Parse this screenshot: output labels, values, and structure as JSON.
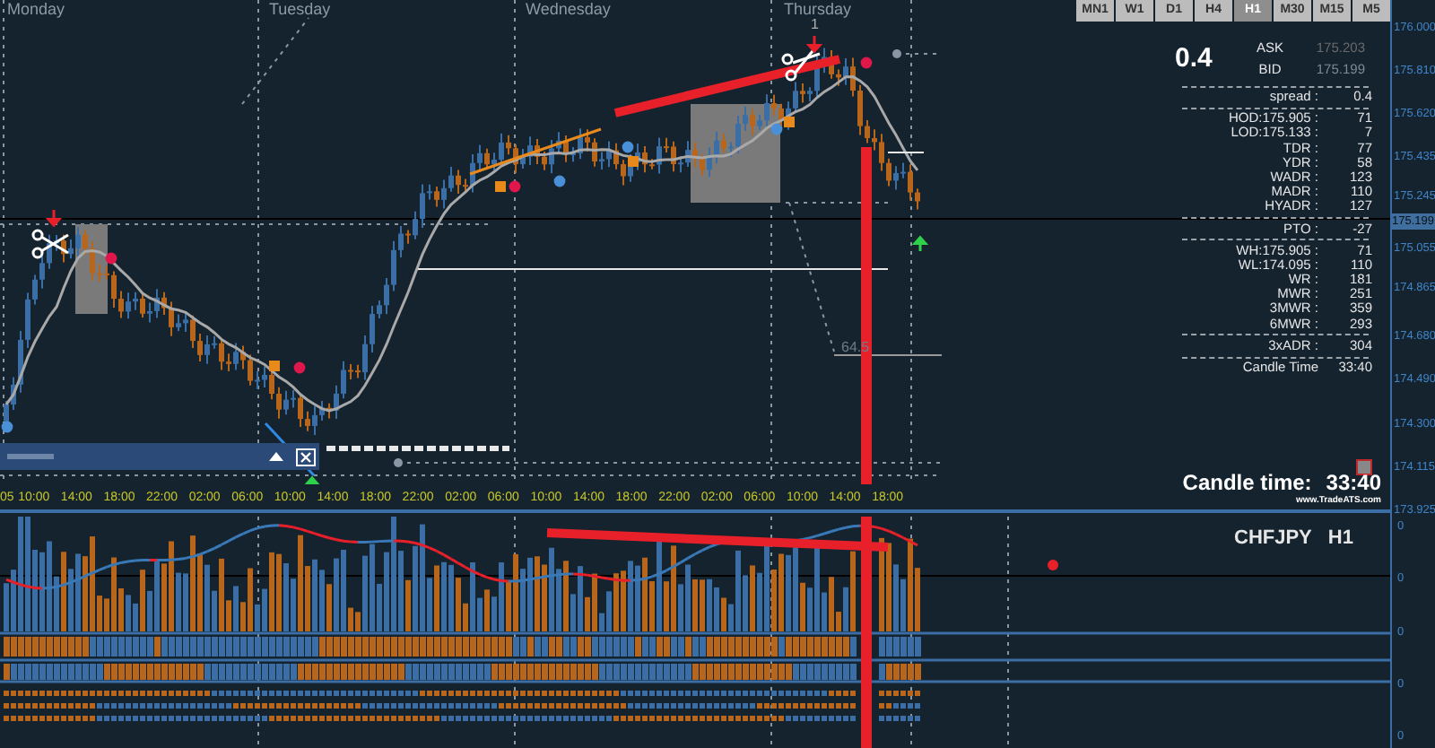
{
  "timeframes": [
    {
      "label": "MN1",
      "selected": false
    },
    {
      "label": "W1",
      "selected": false
    },
    {
      "label": "D1",
      "selected": false
    },
    {
      "label": "H4",
      "selected": false
    },
    {
      "label": "H1",
      "selected": true
    },
    {
      "label": "M30",
      "selected": false
    },
    {
      "label": "M15",
      "selected": false
    },
    {
      "label": "M5",
      "selected": false
    }
  ],
  "day_labels": [
    "Monday",
    "Tuesday",
    "Wednesday",
    "Thursday"
  ],
  "chart_labels": {
    "signal_count": "1",
    "level": "64.5"
  },
  "time_labels": [
    "05",
    "10:00",
    "14:00",
    "18:00",
    "22:00",
    "02:00",
    "06:00",
    "10:00",
    "14:00",
    "18:00",
    "22:00",
    "02:00",
    "06:00",
    "10:00",
    "14:00",
    "18:00",
    "22:00",
    "02:00",
    "06:00",
    "10:00",
    "14:00",
    "18:00"
  ],
  "price_labels": [
    "176.000",
    "175.810",
    "175.620",
    "175.435",
    "175.245",
    "175.055",
    "174.865",
    "174.680",
    "174.490",
    "174.300",
    "174.115",
    "173.925"
  ],
  "current_price": "175.199",
  "info_panel": {
    "spread": "0.4",
    "ask_label": "ASK",
    "ask": "175.203",
    "bid_label": "BID",
    "bid": "175.199",
    "rows": [
      {
        "kind": "stat",
        "label": "spread :",
        "value": "0.4"
      },
      {
        "kind": "divider"
      },
      {
        "kind": "stat",
        "label": "HOD:175.905 :",
        "value": "71"
      },
      {
        "kind": "stat",
        "label": "LOD:175.133 :",
        "value": "7"
      },
      {
        "kind": "stat",
        "label": "TDR :",
        "value": "77"
      },
      {
        "kind": "stat",
        "label": "YDR :",
        "value": "58"
      },
      {
        "kind": "stat",
        "label": "WADR :",
        "value": "123"
      },
      {
        "kind": "stat",
        "label": "MADR :",
        "value": "110"
      },
      {
        "kind": "stat",
        "label": "HYADR :",
        "value": "127"
      },
      {
        "kind": "divider"
      },
      {
        "kind": "stat",
        "label": "PTO :",
        "value": "-27"
      },
      {
        "kind": "divider"
      },
      {
        "kind": "stat",
        "label": "WH:175.905 :",
        "value": "71"
      },
      {
        "kind": "stat",
        "label": "WL:174.095 :",
        "value": "110"
      },
      {
        "kind": "stat",
        "label": "WR :",
        "value": "181"
      },
      {
        "kind": "stat",
        "label": "MWR :",
        "value": "251"
      },
      {
        "kind": "stat",
        "label": "3MWR :",
        "value": "359"
      },
      {
        "kind": "stat",
        "label": "6MWR :",
        "value": "293"
      },
      {
        "kind": "divider"
      },
      {
        "kind": "stat",
        "label": "3xADR :",
        "value": "304"
      },
      {
        "kind": "divider"
      },
      {
        "kind": "stat",
        "label": "Candle Time",
        "value": "33:40"
      }
    ]
  },
  "candle_time": {
    "label": "Candle time:",
    "value": "33:40",
    "website": "www.TradeATS.com"
  },
  "indicator": {
    "symbol": "CHFJPY",
    "period": "H1",
    "axis_labels": [
      "0",
      "0",
      "0",
      "0",
      "0"
    ]
  }
}
